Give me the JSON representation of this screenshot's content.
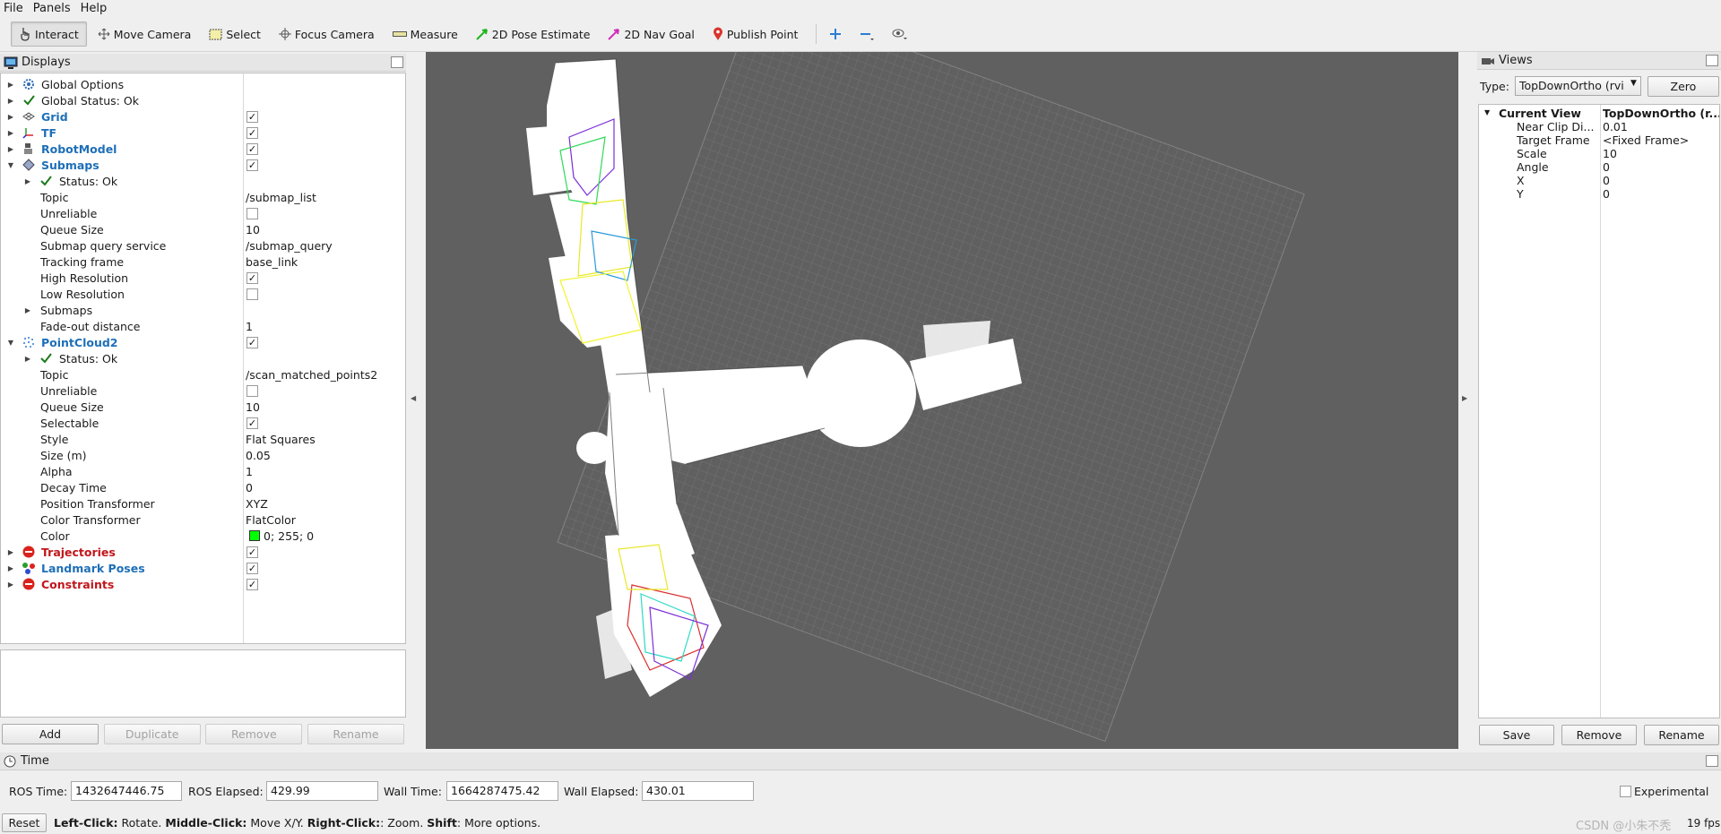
{
  "menu": [
    "File",
    "Panels",
    "Help"
  ],
  "toolbar": {
    "tools": [
      {
        "label": "Interact",
        "icon": "hand-cursor-icon",
        "active": true
      },
      {
        "label": "Move Camera",
        "icon": "move-arrows-icon"
      },
      {
        "label": "Select",
        "icon": "select-box-icon"
      },
      {
        "label": "Focus Camera",
        "icon": "crosshair-icon"
      },
      {
        "label": "Measure",
        "icon": "ruler-icon"
      },
      {
        "label": "2D Pose Estimate",
        "icon": "green-arrow-icon"
      },
      {
        "label": "2D Nav Goal",
        "icon": "pink-arrow-icon"
      },
      {
        "label": "Publish Point",
        "icon": "map-pin-icon"
      }
    ],
    "extra_icons": [
      "plus-icon",
      "minus-icon",
      "eye-icon"
    ]
  },
  "displays": {
    "title": "Displays",
    "rows": [
      {
        "label": "Global Options",
        "value": "",
        "indent": 0,
        "arrow": "right",
        "icon": "gear-icon"
      },
      {
        "label": "Global Status: Ok",
        "value": "",
        "indent": 0,
        "arrow": "right",
        "icon": "check-icon"
      },
      {
        "label": "Grid",
        "value": "",
        "indent": 0,
        "arrow": "right",
        "icon": "grid-icon",
        "style": "blue",
        "check": true
      },
      {
        "label": "TF",
        "value": "",
        "indent": 0,
        "arrow": "right",
        "icon": "tf-axes-icon",
        "style": "blue",
        "check": true
      },
      {
        "label": "RobotModel",
        "value": "",
        "indent": 0,
        "arrow": "right",
        "icon": "robot-icon",
        "style": "blue",
        "check": true
      },
      {
        "label": "Submaps",
        "value": "",
        "indent": 0,
        "arrow": "down",
        "icon": "submaps-icon",
        "style": "blue",
        "check": true
      },
      {
        "label": "Status: Ok",
        "value": "",
        "indent": 1,
        "arrow": "right",
        "icon": "check-icon"
      },
      {
        "label": "Topic",
        "value": "/submap_list",
        "indent": 1
      },
      {
        "label": "Unreliable",
        "value": "",
        "indent": 1,
        "check": false
      },
      {
        "label": "Queue Size",
        "value": "10",
        "indent": 1
      },
      {
        "label": "Submap query service",
        "value": "/submap_query",
        "indent": 1
      },
      {
        "label": "Tracking frame",
        "value": "base_link",
        "indent": 1
      },
      {
        "label": "High Resolution",
        "value": "",
        "indent": 1,
        "check": true
      },
      {
        "label": "Low Resolution",
        "value": "",
        "indent": 1,
        "check": false
      },
      {
        "label": "Submaps",
        "value": "",
        "indent": 1,
        "arrow": "right"
      },
      {
        "label": "Fade-out distance",
        "value": "1",
        "indent": 1
      },
      {
        "label": "PointCloud2",
        "value": "",
        "indent": 0,
        "arrow": "down",
        "icon": "pointcloud-icon",
        "style": "blue",
        "check": true
      },
      {
        "label": "Status: Ok",
        "value": "",
        "indent": 1,
        "arrow": "right",
        "icon": "check-icon"
      },
      {
        "label": "Topic",
        "value": "/scan_matched_points2",
        "indent": 1
      },
      {
        "label": "Unreliable",
        "value": "",
        "indent": 1,
        "check": false
      },
      {
        "label": "Queue Size",
        "value": "10",
        "indent": 1
      },
      {
        "label": "Selectable",
        "value": "",
        "indent": 1,
        "check": true
      },
      {
        "label": "Style",
        "value": "Flat Squares",
        "indent": 1
      },
      {
        "label": "Size (m)",
        "value": "0.05",
        "indent": 1
      },
      {
        "label": "Alpha",
        "value": "1",
        "indent": 1
      },
      {
        "label": "Decay Time",
        "value": "0",
        "indent": 1
      },
      {
        "label": "Position Transformer",
        "value": "XYZ",
        "indent": 1
      },
      {
        "label": "Color Transformer",
        "value": "FlatColor",
        "indent": 1
      },
      {
        "label": "Color",
        "value": "0; 255; 0",
        "indent": 1,
        "swatch": "#00ff00"
      },
      {
        "label": "Trajectories",
        "value": "",
        "indent": 0,
        "arrow": "right",
        "icon": "error-icon",
        "style": "red",
        "check": true
      },
      {
        "label": "Landmark Poses",
        "value": "",
        "indent": 0,
        "arrow": "right",
        "icon": "landmark-icon",
        "style": "blue",
        "check": true
      },
      {
        "label": "Constraints",
        "value": "",
        "indent": 0,
        "arrow": "right",
        "icon": "error-icon",
        "style": "red",
        "check": true
      }
    ],
    "buttons": {
      "add": "Add",
      "duplicate": "Duplicate",
      "remove": "Remove",
      "rename": "Rename"
    }
  },
  "views": {
    "title": "Views",
    "type_label": "Type:",
    "type_value": "TopDownOrtho (rvi",
    "zero": "Zero",
    "rows": [
      {
        "label": "Current View",
        "value": "TopDownOrtho (r...",
        "header": true
      },
      {
        "label": "Near Clip Di...",
        "value": "0.01"
      },
      {
        "label": "Target Frame",
        "value": "<Fixed Frame>"
      },
      {
        "label": "Scale",
        "value": "10"
      },
      {
        "label": "Angle",
        "value": "0"
      },
      {
        "label": "X",
        "value": "0"
      },
      {
        "label": "Y",
        "value": "0"
      }
    ],
    "buttons": {
      "save": "Save",
      "remove": "Remove",
      "rename": "Rename"
    }
  },
  "time": {
    "title": "Time",
    "ros_time_label": "ROS Time:",
    "ros_time": "1432647446.75",
    "ros_elapsed_label": "ROS Elapsed:",
    "ros_elapsed": "429.99",
    "wall_time_label": "Wall Time:",
    "wall_time": "1664287475.42",
    "wall_elapsed_label": "Wall Elapsed:",
    "wall_elapsed": "430.01",
    "experimental": "Experimental"
  },
  "status": {
    "reset": "Reset",
    "hint_parts": [
      {
        "text": "Left-Click:",
        "bold": true
      },
      {
        "text": " Rotate. ",
        "bold": false
      },
      {
        "text": "Middle-Click:",
        "bold": true
      },
      {
        "text": " Move X/Y. ",
        "bold": false
      },
      {
        "text": "Right-Click:",
        "bold": true
      },
      {
        "text": ": Zoom. ",
        "bold": false
      },
      {
        "text": "Shift",
        "bold": true
      },
      {
        "text": ": More options.",
        "bold": false
      }
    ],
    "fps": "19 fps",
    "watermark": "CSDN @小朱不秃"
  },
  "colors": {
    "viewport_bg": "#606060",
    "blue_label": "#1e6fb8",
    "red_label": "#c0161b",
    "map_free": "#ffffff",
    "grid_line": "#7a7a7a"
  }
}
